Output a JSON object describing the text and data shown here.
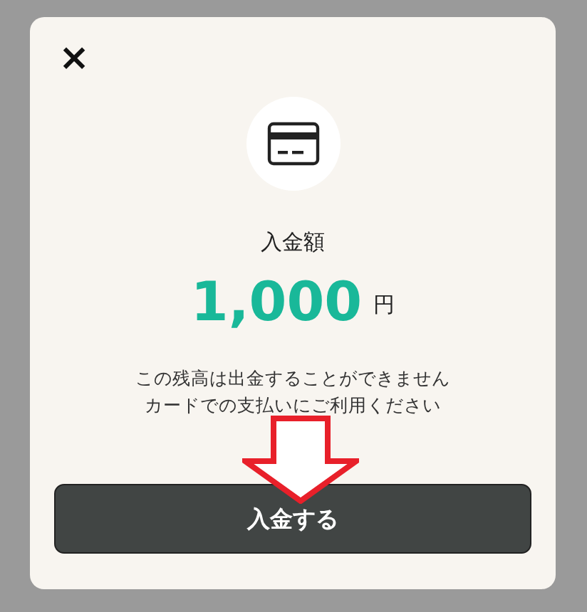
{
  "dialog": {
    "close": "×",
    "label": "入金額",
    "amount": "1,000",
    "unit": "円",
    "notes": [
      "この残高は出金することができません",
      "カードでの支払いにご利用ください"
    ],
    "button": "入金する"
  }
}
